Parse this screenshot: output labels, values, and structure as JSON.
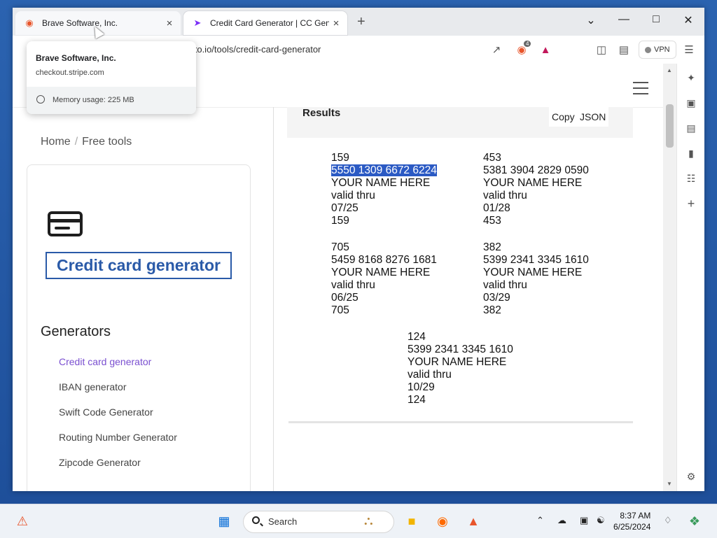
{
  "browser": {
    "tabs": [
      {
        "title": "Brave Software, Inc.",
        "favicon": "brave-lion-icon"
      },
      {
        "title": "Credit Card Generator | CC Gene",
        "favicon": "paper-plane-icon"
      }
    ],
    "new_tab": "+",
    "url": "akto.io/tools/credit-card-generator",
    "vpn_label": "VPN",
    "brave_badge": "4",
    "hover_card": {
      "title": "Brave Software, Inc.",
      "url": "checkout.stripe.com",
      "memory": "Memory usage: 225 MB"
    }
  },
  "page": {
    "breadcrumb": {
      "home": "Home",
      "sep": "/",
      "current": "Free tools"
    },
    "hero_title": "Credit card generator",
    "generators_heading": "Generators",
    "generators": [
      "Credit card generator",
      "IBAN generator",
      "Swift Code Generator",
      "Routing Number Generator",
      "Zipcode Generator"
    ],
    "results": {
      "title": "Results",
      "copy": "Copy",
      "json": "JSON",
      "cards": [
        {
          "cvv_top": "159",
          "number": "5550 1309 6672 6224",
          "name": "YOUR NAME HERE",
          "valid": "valid thru",
          "exp": "07/25",
          "cvv_bottom": "159"
        },
        {
          "cvv_top": "453",
          "number": "5381 3904 2829 0590",
          "name": "YOUR NAME HERE",
          "valid": "valid thru",
          "exp": "01/28",
          "cvv_bottom": "453"
        },
        {
          "cvv_top": "705",
          "number": "5459 8168 8276 1681",
          "name": "YOUR NAME HERE",
          "valid": "valid thru",
          "exp": "06/25",
          "cvv_bottom": "705"
        },
        {
          "cvv_top": "382",
          "number": "5399 2341 3345 1610",
          "name": "YOUR NAME HERE",
          "valid": "valid thru",
          "exp": "03/29",
          "cvv_bottom": "382"
        },
        {
          "cvv_top": "124",
          "number": "5399 2341 3345 1610",
          "name": "YOUR NAME HERE",
          "valid": "valid thru",
          "exp": "10/29",
          "cvv_bottom": "124"
        }
      ]
    }
  },
  "taskbar": {
    "search_label": "Search",
    "time": "8:37 AM",
    "date": "6/25/2024"
  },
  "colors": {
    "accent_link": "#7a4fd0",
    "hero_blue": "#2a5aa8",
    "selection": "#2b5ac4"
  }
}
